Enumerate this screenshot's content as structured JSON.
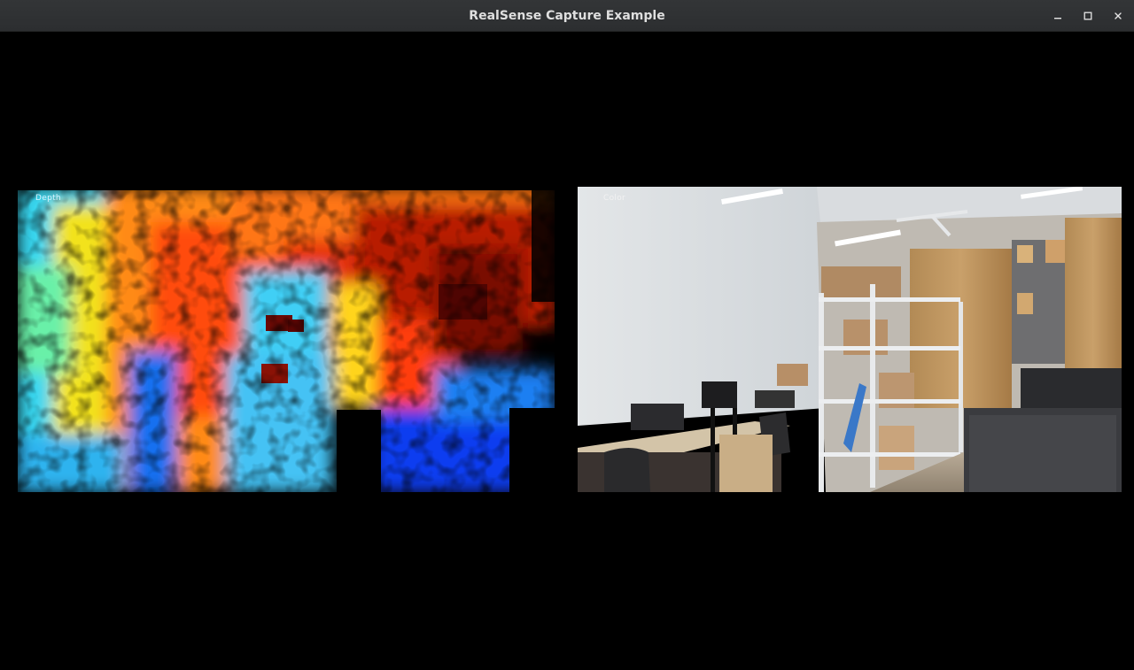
{
  "window": {
    "title": "RealSense Capture Example",
    "controls": {
      "minimize_icon": "minimize-icon",
      "maximize_icon": "maximize-icon",
      "close_icon": "close-icon"
    }
  },
  "streams": {
    "depth": {
      "label": "Depth"
    },
    "color": {
      "label": "Color"
    }
  },
  "colors": {
    "titlebar": "#2f3133",
    "background": "#000000",
    "title_text": "#dfdfdf"
  }
}
